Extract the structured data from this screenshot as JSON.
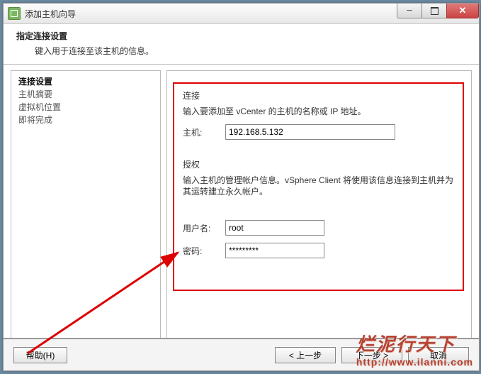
{
  "window": {
    "title": "添加主机向导"
  },
  "header": {
    "title": "指定连接设置",
    "subtitle": "键入用于连接至该主机的信息。"
  },
  "sidebar": {
    "items": [
      {
        "label": "连接设置",
        "active": true
      },
      {
        "label": "主机摘要",
        "active": false
      },
      {
        "label": "虚拟机位置",
        "active": false
      },
      {
        "label": "即将完成",
        "active": false
      }
    ]
  },
  "main": {
    "connection": {
      "group_label": "连接",
      "description": "输入要添加至 vCenter 的主机的名称或 IP 地址。",
      "host_label": "主机:",
      "host_value": "192.168.5.132"
    },
    "auth": {
      "group_label": "授权",
      "description": "输入主机的管理帐户信息。vSphere Client 将使用该信息连接到主机并为其运转建立永久帐户。",
      "user_label": "用户名:",
      "user_value": "root",
      "pass_label": "密码:",
      "pass_value": "*********"
    }
  },
  "footer": {
    "help": "帮助(H)",
    "back": "< 上一步",
    "next": "下一步 >",
    "cancel": "取消"
  },
  "watermark": {
    "text": "烂泥行天下",
    "url": "http://www.ilanni.com"
  }
}
